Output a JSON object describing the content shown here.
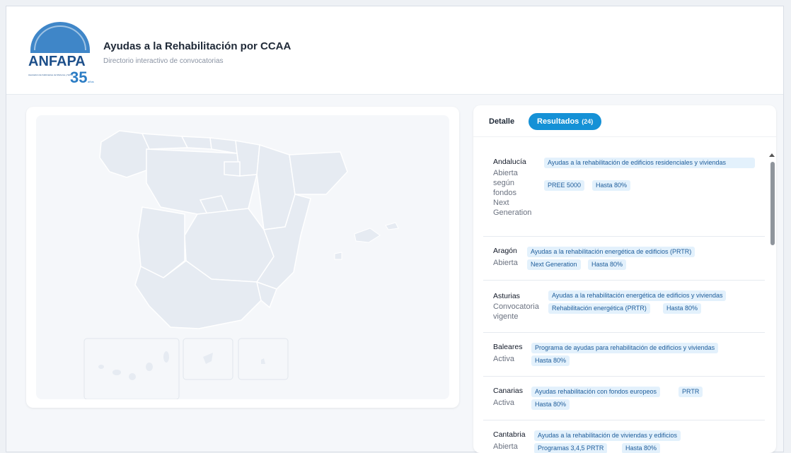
{
  "header": {
    "logo_text": "ANFAPA",
    "logo_badge": "35",
    "logo_small": "años",
    "logo_caption": "Asociación de Fabricantes de Morteros y SATE",
    "title": "Ayudas a la Rehabilitación por CCAA",
    "subtitle": "Directorio interactivo de convocatorias"
  },
  "tabs": {
    "detail_label": "Detalle",
    "results_label": "Resultados",
    "results_count": "(24)"
  },
  "results": [
    {
      "region": "Andalucía",
      "status": "Abierta según fondos Next Generation",
      "tags": [
        "Ayudas a la rehabilitación de edificios residenciales y viviendas",
        "PREE 5000",
        "Hasta 80%"
      ]
    },
    {
      "region": "Aragón",
      "status": "Abierta",
      "tags": [
        "Ayudas a la rehabilitación energética de edificios (PRTR)",
        "Next Generation",
        "Hasta 80%"
      ]
    },
    {
      "region": "Asturias",
      "status": "Convocatoria vigente",
      "tags": [
        "Ayudas a la rehabilitación energética de edificios y viviendas",
        "Rehabilitación energética (PRTR)",
        "Hasta 80%"
      ]
    },
    {
      "region": "Baleares",
      "status": "Activa",
      "tags": [
        "Programa de ayudas para rehabilitación de edificios y viviendas",
        "Hasta 80%"
      ]
    },
    {
      "region": "Canarias",
      "status": "Activa",
      "tags": [
        "Ayudas rehabilitación con fondos europeos",
        "PRTR",
        "Hasta 80%"
      ]
    },
    {
      "region": "Cantabria",
      "status": "Abierta",
      "tags": [
        "Ayudas a la rehabilitación de viviendas y edificios",
        "Programas 3,4,5 PRTR",
        "Hasta 80%"
      ]
    }
  ],
  "colors": {
    "accent": "#1591d6",
    "tag_bg": "#e3f1fc",
    "tag_text": "#1d5c9a",
    "map_fill": "#e6ebf2",
    "map_stroke": "#ffffff"
  }
}
